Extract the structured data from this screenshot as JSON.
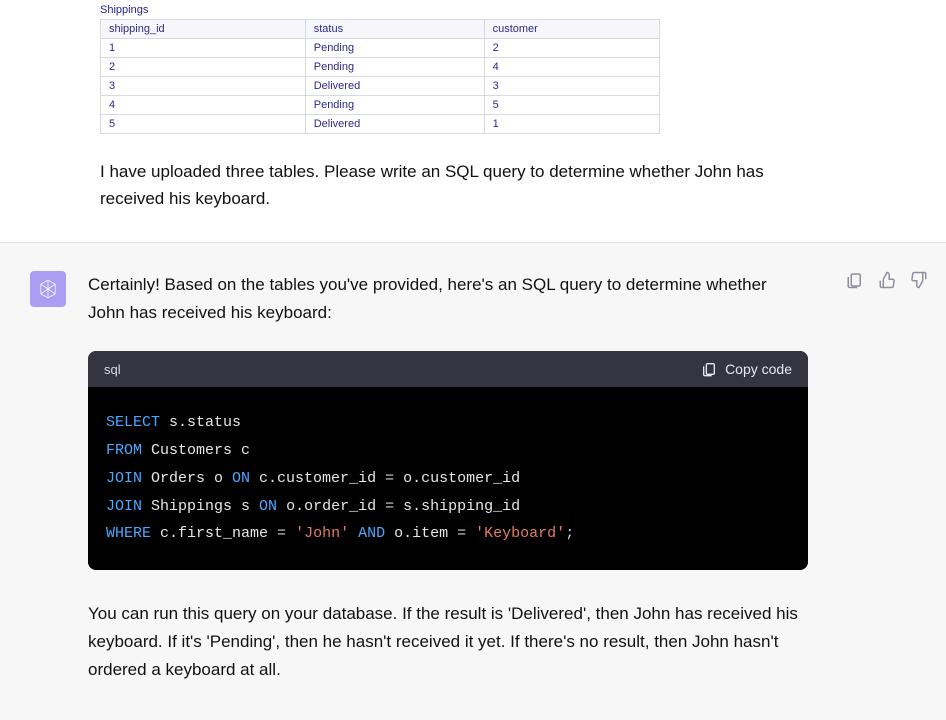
{
  "user": {
    "table": {
      "caption": "Shippings",
      "headers": [
        "shipping_id",
        "status",
        "customer"
      ],
      "rows": [
        [
          "1",
          "Pending",
          "2"
        ],
        [
          "2",
          "Pending",
          "4"
        ],
        [
          "3",
          "Delivered",
          "3"
        ],
        [
          "4",
          "Pending",
          "5"
        ],
        [
          "5",
          "Delivered",
          "1"
        ]
      ]
    },
    "message": "I have uploaded three tables. Please write an SQL query to determine whether John has received his keyboard."
  },
  "assistant": {
    "intro": "Certainly! Based on the tables you've provided, here's an SQL query to determine whether John has received his keyboard:",
    "code": {
      "language": "sql",
      "copy_label": "Copy code",
      "tokens": [
        {
          "t": "SELECT",
          "c": "kw"
        },
        {
          "t": " s.status\n",
          "c": "id"
        },
        {
          "t": "FROM",
          "c": "kw"
        },
        {
          "t": " Customers c\n",
          "c": "id"
        },
        {
          "t": "JOIN",
          "c": "kw"
        },
        {
          "t": " Orders o ",
          "c": "id"
        },
        {
          "t": "ON",
          "c": "kw"
        },
        {
          "t": " c.customer_id ",
          "c": "id"
        },
        {
          "t": "=",
          "c": "op"
        },
        {
          "t": " o.customer_id\n",
          "c": "id"
        },
        {
          "t": "JOIN",
          "c": "kw"
        },
        {
          "t": " Shippings s ",
          "c": "id"
        },
        {
          "t": "ON",
          "c": "kw"
        },
        {
          "t": " o.order_id ",
          "c": "id"
        },
        {
          "t": "=",
          "c": "op"
        },
        {
          "t": " s.shipping_id\n",
          "c": "id"
        },
        {
          "t": "WHERE",
          "c": "kw"
        },
        {
          "t": " c.first_name ",
          "c": "id"
        },
        {
          "t": "=",
          "c": "op"
        },
        {
          "t": " ",
          "c": "id"
        },
        {
          "t": "'John'",
          "c": "str"
        },
        {
          "t": " ",
          "c": "id"
        },
        {
          "t": "AND",
          "c": "kw"
        },
        {
          "t": " o.item ",
          "c": "id"
        },
        {
          "t": "=",
          "c": "op"
        },
        {
          "t": " ",
          "c": "id"
        },
        {
          "t": "'Keyboard'",
          "c": "str"
        },
        {
          "t": ";",
          "c": "op"
        }
      ]
    },
    "outro": "You can run this query on your database. If the result is 'Delivered', then John has received his keyboard. If it's 'Pending', then he hasn't received it yet. If there's no result, then John hasn't ordered a keyboard at all."
  }
}
